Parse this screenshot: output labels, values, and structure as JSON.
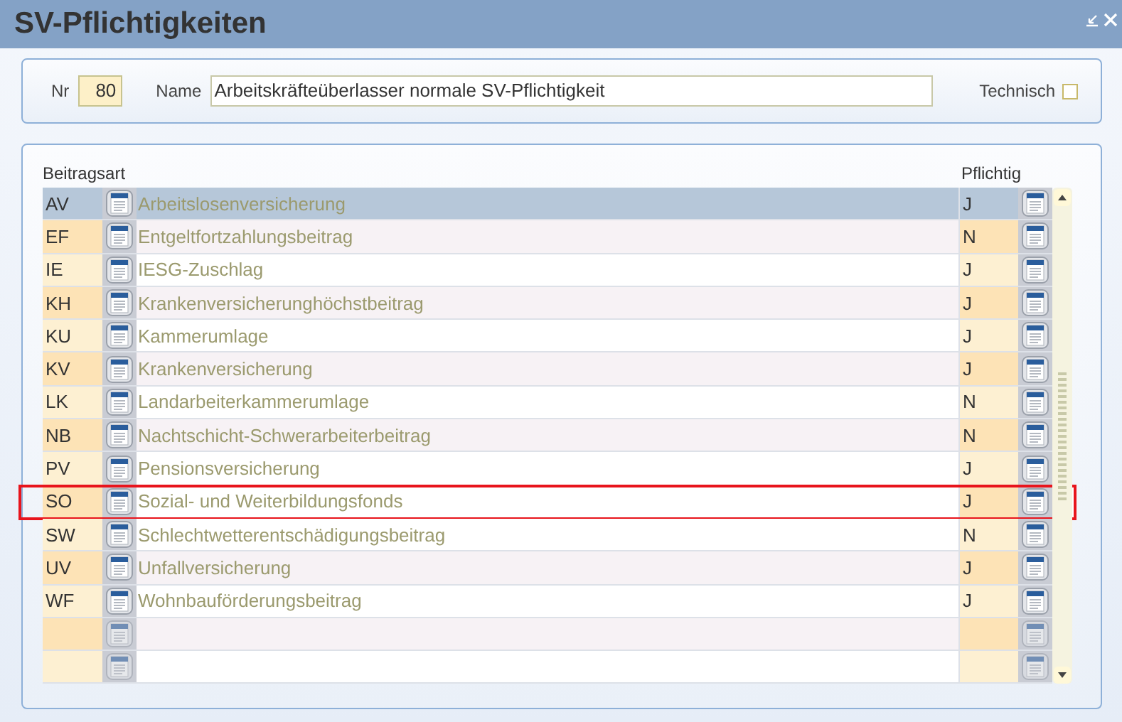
{
  "window": {
    "title": "SV-Pflichtigkeiten"
  },
  "header": {
    "nr_label": "Nr",
    "nr_value": "80",
    "name_label": "Name",
    "name_value": "Arbeitskräfteüberlasser normale SV-Pflichtigkeit",
    "technisch_label": "Technisch",
    "technisch_checked": false
  },
  "table": {
    "columns": [
      "Beitragsart",
      "Pflichtig"
    ],
    "rows": [
      {
        "kind": "entry",
        "code": "AV",
        "description": "Arbeitslosenversicherung",
        "pflichtig": "J",
        "selected": true,
        "focused": false
      },
      {
        "kind": "entry",
        "code": "EF",
        "description": "Entgeltfortzahlungsbeitrag",
        "pflichtig": "N",
        "selected": false,
        "focused": false
      },
      {
        "kind": "entry",
        "code": "IE",
        "description": "IESG-Zuschlag",
        "pflichtig": "J",
        "selected": false,
        "focused": false
      },
      {
        "kind": "entry",
        "code": "KH",
        "description": "Krankenversicherunghöchstbeitrag",
        "pflichtig": "J",
        "selected": false,
        "focused": false
      },
      {
        "kind": "entry",
        "code": "KU",
        "description": "Kammerumlage",
        "pflichtig": "J",
        "selected": false,
        "focused": false
      },
      {
        "kind": "entry",
        "code": "KV",
        "description": "Krankenversicherung",
        "pflichtig": "J",
        "selected": false,
        "focused": false
      },
      {
        "kind": "entry",
        "code": "LK",
        "description": "Landarbeiterkammerumlage",
        "pflichtig": "N",
        "selected": false,
        "focused": false
      },
      {
        "kind": "entry",
        "code": "NB",
        "description": "Nachtschicht-Schwerarbeiterbeitrag",
        "pflichtig": "N",
        "selected": false,
        "focused": false
      },
      {
        "kind": "entry",
        "code": "PV",
        "description": "Pensionsversicherung",
        "pflichtig": "J",
        "selected": false,
        "focused": false
      },
      {
        "kind": "entry",
        "code": "SO",
        "description": "Sozial- und Weiterbildungsfonds",
        "pflichtig": "J",
        "selected": false,
        "focused": true
      },
      {
        "kind": "entry",
        "code": "SW",
        "description": "Schlechtwetterentschädigungsbeitrag",
        "pflichtig": "N",
        "selected": false,
        "focused": false
      },
      {
        "kind": "entry",
        "code": "UV",
        "description": "Unfallversicherung",
        "pflichtig": "J",
        "selected": false,
        "focused": false
      },
      {
        "kind": "entry",
        "code": "WF",
        "description": "Wohnbauförderungsbeitrag",
        "pflichtig": "J",
        "selected": false,
        "focused": false
      },
      {
        "kind": "empty",
        "selected": false,
        "focused": false
      },
      {
        "kind": "empty",
        "selected": false,
        "focused": false
      }
    ]
  }
}
